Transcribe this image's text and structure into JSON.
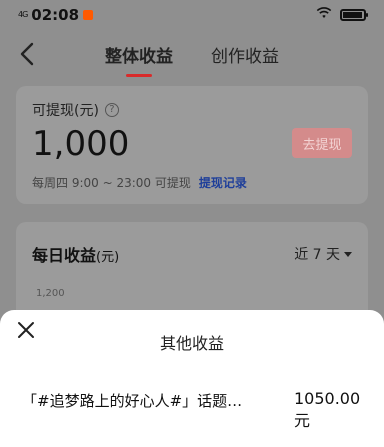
{
  "status": {
    "signal": "4G",
    "time": "02:08",
    "battery_level": 0.85
  },
  "nav": {
    "tabs": [
      {
        "label": "整体收益",
        "active": true
      },
      {
        "label": "创作收益",
        "active": false
      }
    ]
  },
  "withdraw": {
    "label": "可提现(元)",
    "help_icon": "question-icon",
    "amount": "1,000",
    "button_label": "去提现",
    "note": "每周四 9:00 ~ 23:00 可提现",
    "record_link": "提现记录"
  },
  "daily": {
    "title": "每日收益",
    "unit": "(元)",
    "range_label": "近 7 天",
    "tick_top": "1,200"
  },
  "sheet": {
    "title": "其他收益",
    "items": [
      {
        "label": "「#追梦路上的好心人#」话题…",
        "value": "1050.00\n元"
      }
    ]
  },
  "colors": {
    "accent": "#d92b2b",
    "link": "#1f3f9a",
    "overlay": "#8f8f8f"
  }
}
